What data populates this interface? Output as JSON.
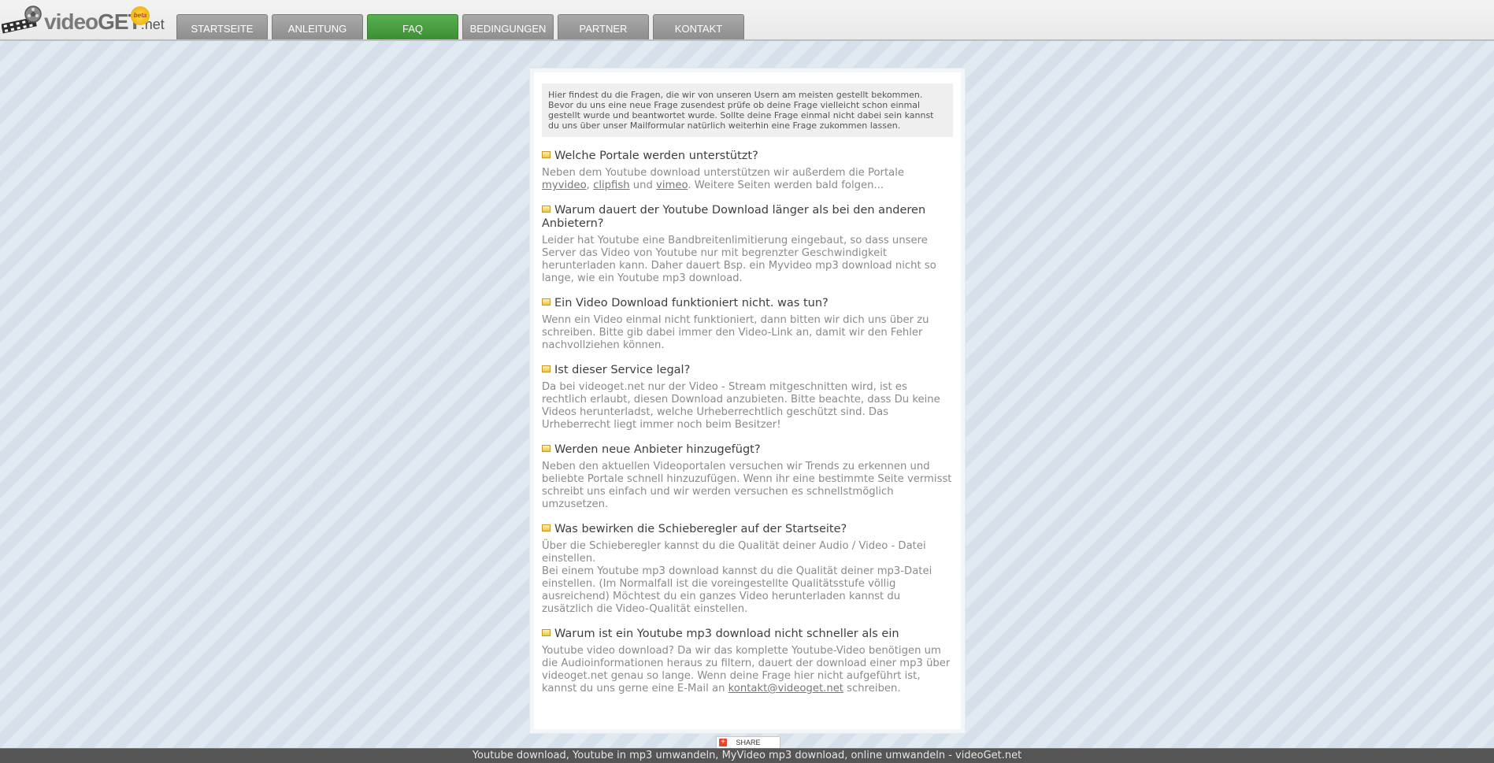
{
  "logo": {
    "text_video": "video",
    "text_get": "GET",
    "text_net": ".net",
    "badge": "beta"
  },
  "nav": {
    "tabs": [
      {
        "label": "STARTSEITE",
        "active": false
      },
      {
        "label": "ANLEITUNG",
        "active": false
      },
      {
        "label": "FAQ",
        "active": true
      },
      {
        "label": "BEDINGUNGEN",
        "active": false
      },
      {
        "label": "PARTNER",
        "active": false
      },
      {
        "label": "KONTAKT",
        "active": false
      }
    ]
  },
  "intro": "Hier findest du die Fragen, die wir von unseren Usern am meisten gestellt bekommen. Bevor du uns eine neue Frage zusendest prüfe ob deine Frage vielleicht schon einmal gestellt wurde und beantwortet wurde. Sollte deine Frage einmal nicht dabei sein kannst du uns über unser Mailformular natürlich weiterhin eine Frage zukommen lassen.",
  "faq": [
    {
      "question": "Welche Portale werden unterstützt?",
      "answer_prefix": "Neben dem Youtube download unterstützen wir außerdem die Portale ",
      "link1": "myvideo",
      "sep1": ", ",
      "link2": "clipfish",
      "sep2": " und ",
      "link3": "vimeo",
      "answer_suffix": ". Weitere Seiten werden bald folgen..."
    },
    {
      "question": "Warum dauert der Youtube Download länger als bei den anderen Anbietern?",
      "answer": "Leider hat Youtube eine Bandbreitenlimitierung eingebaut, so dass unsere Server das Video von Youtube nur mit begrenzter Geschwindigkeit herunterladen kann. Daher dauert Bsp. ein Myvideo mp3 download nicht so lange, wie ein Youtube mp3 download."
    },
    {
      "question": "Ein Video Download funktioniert nicht. was tun?",
      "answer": "Wenn ein Video einmal nicht funktioniert, dann bitten wir dich uns über zu schreiben. Bitte gib dabei immer den Video-Link an, damit wir den Fehler nachvollziehen können."
    },
    {
      "question": "Ist dieser Service legal?",
      "answer": "Da bei videoget.net nur der Video - Stream mitgeschnitten wird, ist es rechtlich erlaubt, diesen Download anzubieten. Bitte beachte, dass Du keine Videos herunterladst, welche Urheberrechtlich geschützt sind. Das Urheberrecht liegt immer noch beim Besitzer!"
    },
    {
      "question": "Werden neue Anbieter hinzugefügt?",
      "answer": "Neben den aktuellen Videoportalen versuchen wir Trends zu erkennen und beliebte Portale schnell hinzuzufügen. Wenn ihr eine bestimmte Seite vermisst schreibt uns einfach und wir werden versuchen es schnellstmöglich umzusetzen."
    },
    {
      "question": "Was bewirken die Schieberegler auf der Startseite?",
      "answer_line1": "Über die Schieberegler kannst du die Qualität deiner Audio / Video - Datei einstellen.",
      "answer_line2": "Bei einem Youtube mp3 download  kannst du die Qualität deiner mp3-Datei einstellen. (Im Normalfall ist die voreingestellte Qualitätsstufe völlig ausreichend) Möchtest du ein ganzes Video herunterladen kannst du zusätzlich die Video-Qualität einstellen."
    },
    {
      "question": "Warum ist ein Youtube mp3 download nicht schneller als ein",
      "answer_prefix": "Youtube video  download? Da wir das komplette Youtube-Video benötigen um die Audioinformationen heraus zu filtern, dauert der download einer mp3 über videoget.net genau so lange. Wenn deine Frage hier nicht aufgeführt ist, kannst du uns gerne eine E-Mail an ",
      "email": "kontakt@videoget.net",
      "answer_suffix": " schreiben."
    }
  ],
  "share": {
    "label": "SHARE"
  },
  "footer": {
    "text": "Youtube download, Youtube in mp3 umwandeln, MyVideo mp3 download, online umwandeln - videoGet.net"
  },
  "colors": {
    "tab_active": "#4aa041",
    "tab_inactive": "#9b9b9b",
    "footer_bg": "#555555"
  }
}
